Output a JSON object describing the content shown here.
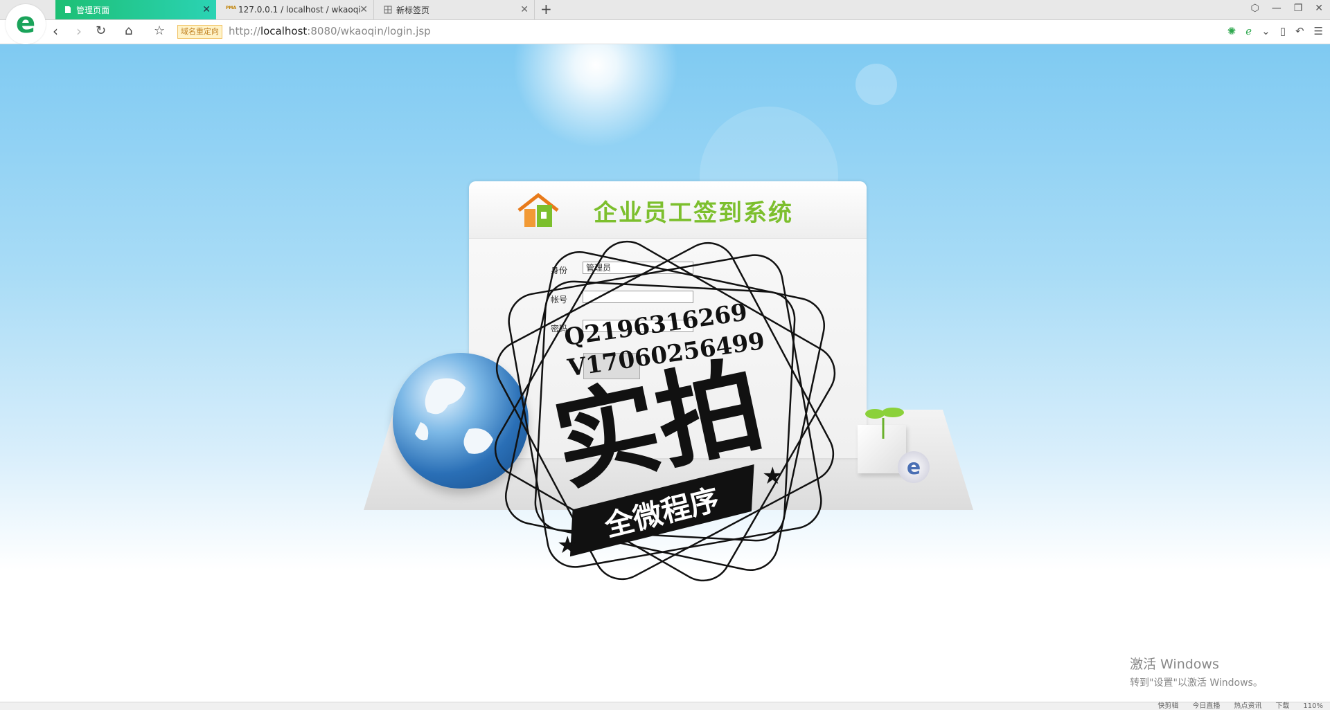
{
  "browser": {
    "tabs": [
      {
        "label": "管理页面",
        "active": true
      },
      {
        "label": "127.0.0.1 / localhost / wkaoqi",
        "active": false,
        "icon_text": "PMA"
      },
      {
        "label": "新标签页",
        "active": false
      }
    ],
    "address": {
      "badge": "域名重定向",
      "url_prefix": "http://",
      "url_host": "localhost",
      "url_rest": ":8080/wkaoqin/login.jsp"
    },
    "statusbar": {
      "items": [
        "快剪辑",
        "今日直播",
        "热点资讯",
        "下载",
        "110%"
      ]
    }
  },
  "page": {
    "system_title": "企业员工签到系统",
    "form": {
      "identity_label": "身份",
      "identity_value": "管理员",
      "account_label": "帐号",
      "password_label": "密码"
    }
  },
  "watermark": {
    "line1": "Q2196316269",
    "line2": "V17060256499",
    "big_text": "实拍",
    "banner_text": "全微程序"
  },
  "windows_activation": {
    "title": "激活 Windows",
    "subtitle": "转到\"设置\"以激活 Windows。"
  },
  "colors": {
    "tab_active": "#1dbf74",
    "title_green": "#7cbf2d",
    "sky": "#7fcaf2"
  }
}
